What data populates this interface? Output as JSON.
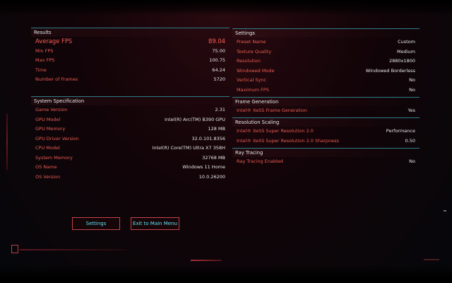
{
  "results": {
    "title": "Results",
    "rows": [
      {
        "label": "Average FPS",
        "value": "89.04"
      },
      {
        "label": "Min FPS",
        "value": "75.00"
      },
      {
        "label": "Max FPS",
        "value": "100.75"
      },
      {
        "label": "Time",
        "value": "64.24"
      },
      {
        "label": "Number of Frames",
        "value": "5720"
      }
    ]
  },
  "system": {
    "title": "System Specification",
    "rows": [
      {
        "label": "Game Version",
        "value": "2.31"
      },
      {
        "label": "GPU Model",
        "value": "Intel(R) Arc(TM) B390 GPU"
      },
      {
        "label": "GPU Memory",
        "value": "128 MB"
      },
      {
        "label": "GPU Driver Version",
        "value": "32.0.101.8356"
      },
      {
        "label": "CPU Model",
        "value": "Intel(R) Core(TM) Ultra X7 358H"
      },
      {
        "label": "System Memory",
        "value": "32768 MB"
      },
      {
        "label": "OS Name",
        "value": "Windows 11 Home"
      },
      {
        "label": "OS Version",
        "value": "10.0.26200"
      }
    ]
  },
  "settings": {
    "title": "Settings",
    "rows": [
      {
        "label": "Preset Name",
        "value": "Custom"
      },
      {
        "label": "Texture Quality",
        "value": "Medium"
      },
      {
        "label": "Resolution",
        "value": "2880x1800"
      },
      {
        "label": "Windowed Mode",
        "value": "Windowed Borderless"
      },
      {
        "label": "Vertical Sync",
        "value": "No"
      },
      {
        "label": "Maximum FPS",
        "value": "No"
      }
    ]
  },
  "frame_generation": {
    "title": "Frame Generation",
    "rows": [
      {
        "label": "Intel® XeSS Frame Generation",
        "value": "Yes"
      }
    ]
  },
  "resolution_scaling": {
    "title": "Resolution Scaling",
    "rows": [
      {
        "label": "Intel® XeSS Super Resolution 2.0",
        "value": "Performance"
      },
      {
        "label": "Intel® XeSS Super Resolution 2.0 Sharpness",
        "value": "0.50"
      }
    ]
  },
  "ray_tracing": {
    "title": "Ray Tracing",
    "rows": [
      {
        "label": "Ray Tracing Enabled",
        "value": "No"
      }
    ]
  },
  "buttons": {
    "settings": "Settings",
    "exit": "Exit to Main Menu"
  },
  "colors": {
    "label_red": "#ec5b50",
    "accent_cyan": "#5fe4ef",
    "divider_teal": "#2f7c86"
  }
}
